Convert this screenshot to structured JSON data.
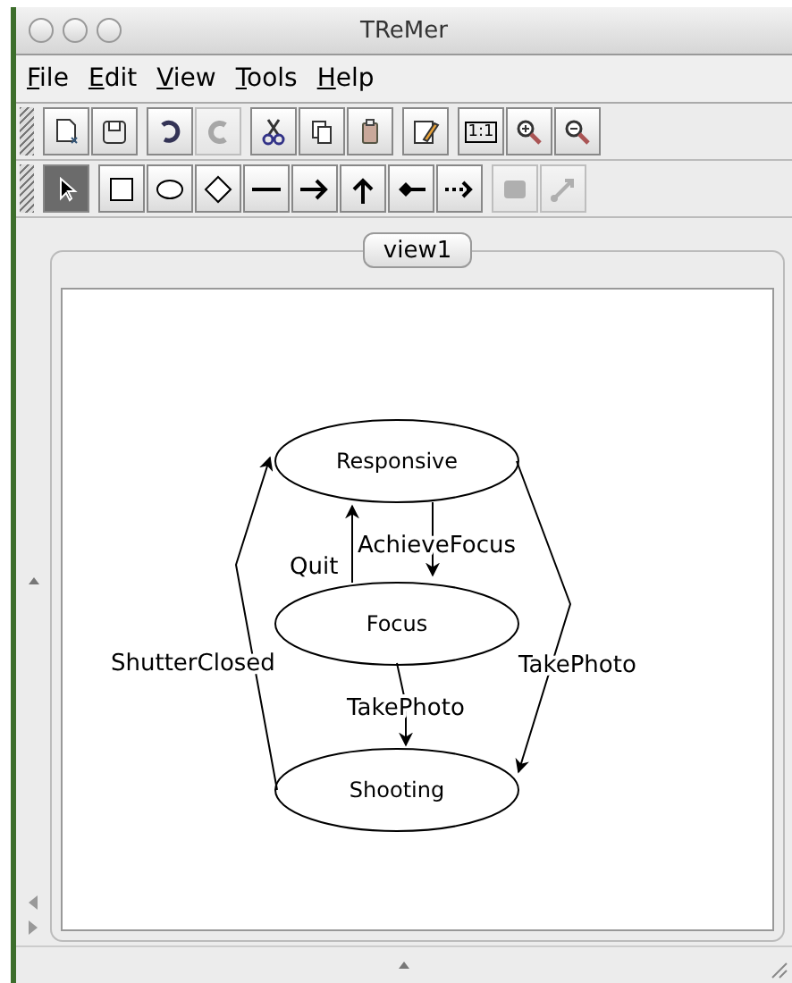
{
  "window": {
    "title": "TReMer"
  },
  "menu": [
    "File",
    "Edit",
    "View",
    "Tools",
    "Help"
  ],
  "toolbars": [
    {
      "groups": [
        [
          {
            "kind": "new",
            "disabled": false
          },
          {
            "kind": "save",
            "disabled": false
          }
        ],
        [
          {
            "kind": "undo",
            "disabled": false
          },
          {
            "kind": "redo",
            "disabled": true
          }
        ],
        [
          {
            "kind": "cut",
            "disabled": false
          },
          {
            "kind": "copy",
            "disabled": false
          },
          {
            "kind": "paste",
            "disabled": false
          }
        ],
        [
          {
            "kind": "edit",
            "disabled": false
          }
        ],
        [
          {
            "kind": "actual-size",
            "label": "1:1",
            "disabled": false
          },
          {
            "kind": "zoom-in",
            "disabled": false
          },
          {
            "kind": "zoom-out",
            "disabled": false
          }
        ]
      ]
    },
    {
      "groups": [
        [
          {
            "kind": "select",
            "selected": true,
            "disabled": false
          }
        ],
        [
          {
            "kind": "rect",
            "selected": false,
            "disabled": false
          },
          {
            "kind": "ellipse",
            "selected": false,
            "disabled": false
          },
          {
            "kind": "diamond",
            "selected": false,
            "disabled": false
          },
          {
            "kind": "line",
            "selected": false,
            "disabled": false
          },
          {
            "kind": "arrow",
            "selected": false,
            "disabled": false
          },
          {
            "kind": "up-arrow",
            "selected": false,
            "disabled": false
          },
          {
            "kind": "diamond-line",
            "selected": false,
            "disabled": false
          },
          {
            "kind": "dotted-arrow",
            "selected": false,
            "disabled": false
          }
        ],
        [
          {
            "kind": "rounded-square",
            "selected": false,
            "disabled": true
          },
          {
            "kind": "diagonal-arrow",
            "selected": false,
            "disabled": true
          }
        ]
      ]
    }
  ],
  "tabs": [
    {
      "label": "view1",
      "selected": true
    }
  ],
  "diagram": {
    "states": [
      "Responsive",
      "Focus",
      "Shooting"
    ],
    "transitions": [
      "AchieveFocus",
      "Quit",
      "TakePhoto",
      "TakePhoto",
      "ShutterClosed"
    ]
  }
}
